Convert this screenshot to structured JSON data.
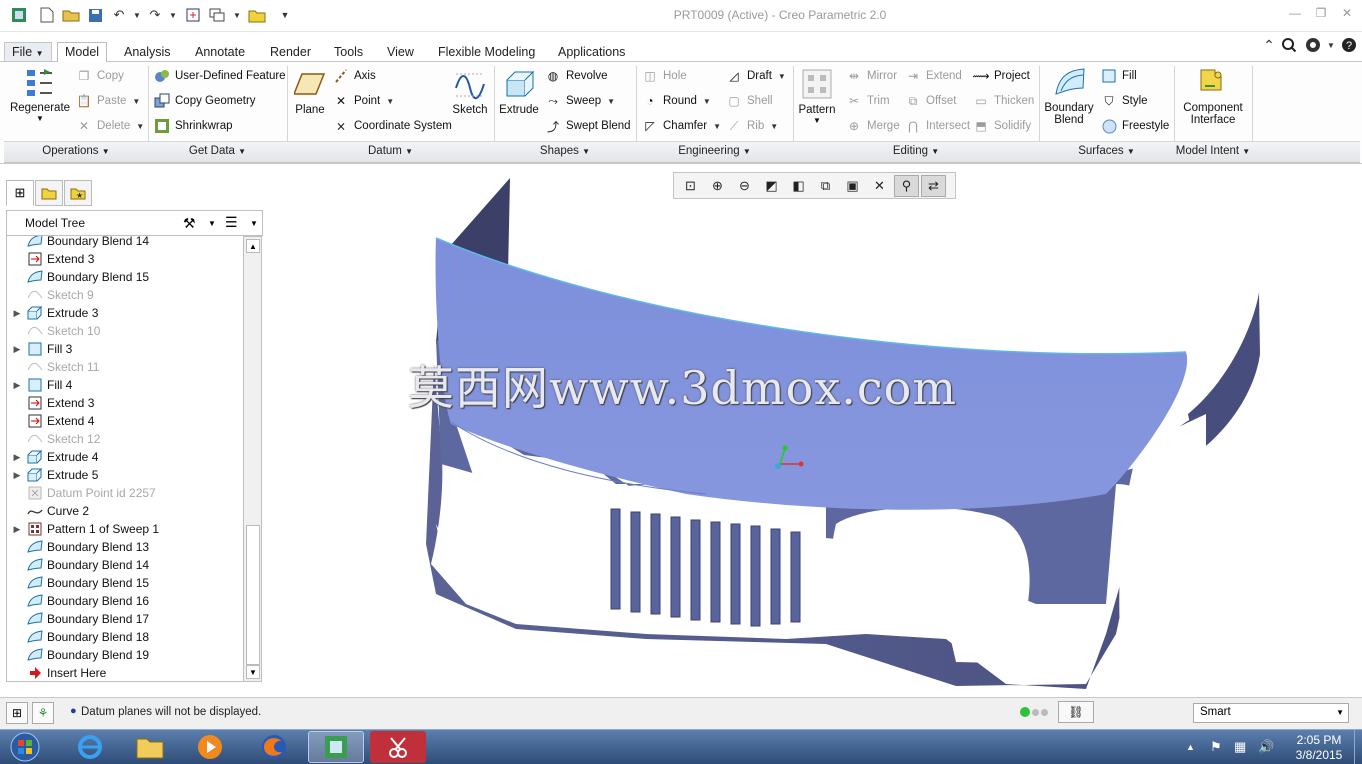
{
  "window": {
    "title": "PRT0009 (Active) - Creo Parametric 2.0"
  },
  "menu_tabs": [
    "File",
    "Model",
    "Analysis",
    "Annotate",
    "Render",
    "Tools",
    "View",
    "Flexible Modeling",
    "Applications"
  ],
  "active_tab": "Model",
  "ribbon": {
    "operations": {
      "regenerate": "Regenerate",
      "copy": "Copy",
      "paste": "Paste",
      "delete": "Delete"
    },
    "get_data": {
      "udf": "User-Defined Feature",
      "copy_geometry": "Copy Geometry",
      "shrinkwrap": "Shrinkwrap"
    },
    "datum": {
      "plane": "Plane",
      "axis": "Axis",
      "point": "Point",
      "csys": "Coordinate System",
      "sketch": "Sketch"
    },
    "shapes": {
      "extrude": "Extrude",
      "revolve": "Revolve",
      "sweep": "Sweep",
      "swept_blend": "Swept Blend"
    },
    "engineering": {
      "hole": "Hole",
      "draft": "Draft",
      "round": "Round",
      "shell": "Shell",
      "chamfer": "Chamfer",
      "rib": "Rib"
    },
    "editing": {
      "pattern": "Pattern",
      "mirror": "Mirror",
      "extend": "Extend",
      "project": "Project",
      "trim": "Trim",
      "offset": "Offset",
      "thicken": "Thicken",
      "merge": "Merge",
      "intersect": "Intersect",
      "solidify": "Solidify"
    },
    "surfaces": {
      "boundary_blend_1": "Boundary",
      "boundary_blend_2": "Blend",
      "fill": "Fill",
      "style": "Style",
      "freestyle": "Freestyle"
    },
    "model_intent": {
      "component_1": "Component",
      "component_2": "Interface"
    },
    "groups": [
      "Operations",
      "Get Data",
      "Datum",
      "Shapes",
      "Engineering",
      "Editing",
      "Surfaces",
      "Model Intent"
    ]
  },
  "model_tree": {
    "title": "Model Tree",
    "items": [
      {
        "label": "Boundary Blend 14",
        "icon": "boundary-blend",
        "dim": false,
        "expand": false
      },
      {
        "label": "Extend 3",
        "icon": "extend",
        "dim": false,
        "expand": false
      },
      {
        "label": "Boundary Blend 15",
        "icon": "boundary-blend",
        "dim": false,
        "expand": false
      },
      {
        "label": "Sketch 9",
        "icon": "sketch",
        "dim": true,
        "expand": false
      },
      {
        "label": "Extrude 3",
        "icon": "extrude",
        "dim": false,
        "expand": true
      },
      {
        "label": "Sketch 10",
        "icon": "sketch",
        "dim": true,
        "expand": false
      },
      {
        "label": "Fill 3",
        "icon": "fill",
        "dim": false,
        "expand": true
      },
      {
        "label": "Sketch 11",
        "icon": "sketch",
        "dim": true,
        "expand": false
      },
      {
        "label": "Fill 4",
        "icon": "fill",
        "dim": false,
        "expand": true
      },
      {
        "label": "Extend 3",
        "icon": "extend",
        "dim": false,
        "expand": false
      },
      {
        "label": "Extend 4",
        "icon": "extend",
        "dim": false,
        "expand": false
      },
      {
        "label": "Sketch 12",
        "icon": "sketch",
        "dim": true,
        "expand": false
      },
      {
        "label": "Extrude 4",
        "icon": "extrude",
        "dim": false,
        "expand": true
      },
      {
        "label": "Extrude 5",
        "icon": "extrude",
        "dim": false,
        "expand": true
      },
      {
        "label": "Datum Point id 2257",
        "icon": "datum-point",
        "dim": true,
        "expand": false
      },
      {
        "label": "Curve 2",
        "icon": "curve",
        "dim": false,
        "expand": false
      },
      {
        "label": "Pattern 1 of Sweep 1",
        "icon": "pattern",
        "dim": false,
        "expand": true
      },
      {
        "label": "Boundary Blend 13",
        "icon": "boundary-blend",
        "dim": false,
        "expand": false
      },
      {
        "label": "Boundary Blend 14",
        "icon": "boundary-blend",
        "dim": false,
        "expand": false
      },
      {
        "label": "Boundary Blend 15",
        "icon": "boundary-blend",
        "dim": false,
        "expand": false
      },
      {
        "label": "Boundary Blend 16",
        "icon": "boundary-blend",
        "dim": false,
        "expand": false
      },
      {
        "label": "Boundary Blend 17",
        "icon": "boundary-blend",
        "dim": false,
        "expand": false
      },
      {
        "label": "Boundary Blend 18",
        "icon": "boundary-blend",
        "dim": false,
        "expand": false
      },
      {
        "label": "Boundary Blend 19",
        "icon": "boundary-blend",
        "dim": false,
        "expand": false
      },
      {
        "label": "Insert Here",
        "icon": "insert-arrow",
        "dim": false,
        "expand": false
      }
    ]
  },
  "viewport": {
    "watermark": "莫西网www.3dmox.com",
    "model_color": "#7f8fd8"
  },
  "status": {
    "message": "Datum planes will not be displayed.",
    "filter": "Smart"
  },
  "taskbar": {
    "time": "2:05 PM",
    "date": "3/8/2015"
  }
}
